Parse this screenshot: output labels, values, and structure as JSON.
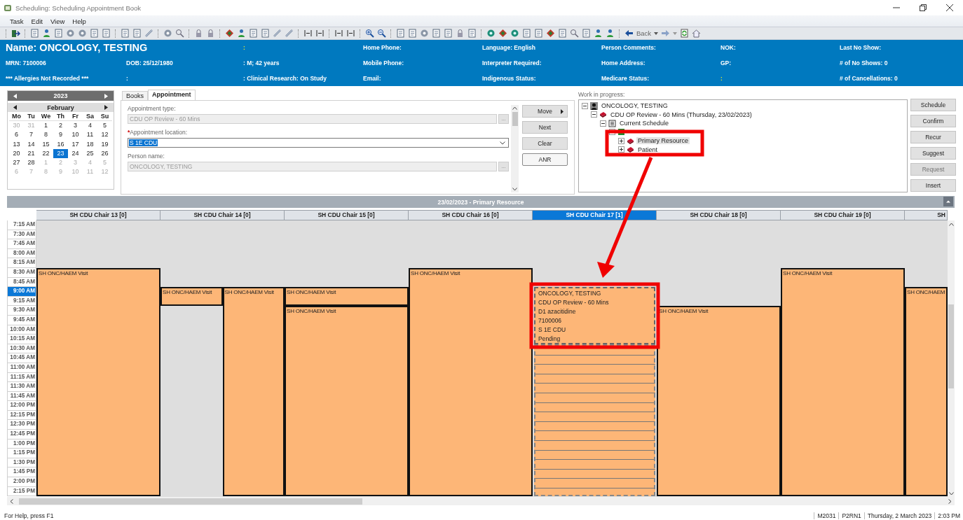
{
  "window": {
    "title": "Scheduling: Scheduling Appointment Book"
  },
  "menu": [
    "Task",
    "Edit",
    "View",
    "Help"
  ],
  "toolbar": {
    "back_label": "Back"
  },
  "banner": {
    "rows": [
      [
        {
          "kind": "name",
          "text": "Name: ONCOLOGY, TESTING"
        },
        {
          "kind": "empty"
        },
        {
          "kind": "flag",
          "text": ":"
        },
        {
          "kind": "label",
          "text": "Home Phone:"
        },
        {
          "kind": "label",
          "text": "Language: English"
        },
        {
          "kind": "label",
          "text": "Person Comments:"
        },
        {
          "kind": "label",
          "text": "NOK:"
        },
        {
          "kind": "label",
          "text": "Last No Show:"
        }
      ],
      [
        {
          "kind": "label",
          "text": "MRN: 7100006"
        },
        {
          "kind": "label",
          "text": "DOB: 25/12/1980"
        },
        {
          "kind": "label",
          "text": ": M; 42 years"
        },
        {
          "kind": "label",
          "text": "Mobile Phone:"
        },
        {
          "kind": "label",
          "text": "Interpreter Required:"
        },
        {
          "kind": "label",
          "text": "Home Address:"
        },
        {
          "kind": "label",
          "text": "GP:"
        },
        {
          "kind": "label",
          "text": "# of No Shows: 0"
        }
      ],
      [
        {
          "kind": "label",
          "text": "*** Allergies Not Recorded ***"
        },
        {
          "kind": "label",
          "text": ":"
        },
        {
          "kind": "label",
          "text": ": Clinical Research: On Study"
        },
        {
          "kind": "label",
          "text": "Email:"
        },
        {
          "kind": "label",
          "text": "Indigenous Status:"
        },
        {
          "kind": "label",
          "text": "Medicare Status:"
        },
        {
          "kind": "flag",
          "text": ":"
        },
        {
          "kind": "label",
          "text": "# of Cancellations: 0"
        }
      ]
    ]
  },
  "calendar": {
    "year": "2023",
    "month": "February",
    "weekdays": [
      "Mo",
      "Tu",
      "We",
      "Th",
      "Fr",
      "Sa",
      "Su"
    ],
    "days": [
      {
        "d": "30",
        "muted": true,
        "selected": false
      },
      {
        "d": "31",
        "muted": true,
        "selected": false
      },
      {
        "d": "1",
        "muted": false,
        "selected": false
      },
      {
        "d": "2",
        "muted": false,
        "selected": false
      },
      {
        "d": "3",
        "muted": false,
        "selected": false
      },
      {
        "d": "4",
        "muted": false,
        "selected": false
      },
      {
        "d": "5",
        "muted": false,
        "selected": false
      },
      {
        "d": "6",
        "muted": false,
        "selected": false
      },
      {
        "d": "7",
        "muted": false,
        "selected": false
      },
      {
        "d": "8",
        "muted": false,
        "selected": false
      },
      {
        "d": "9",
        "muted": false,
        "selected": false
      },
      {
        "d": "10",
        "muted": false,
        "selected": false
      },
      {
        "d": "11",
        "muted": false,
        "selected": false
      },
      {
        "d": "12",
        "muted": false,
        "selected": false
      },
      {
        "d": "13",
        "muted": false,
        "selected": false
      },
      {
        "d": "14",
        "muted": false,
        "selected": false
      },
      {
        "d": "15",
        "muted": false,
        "selected": false
      },
      {
        "d": "16",
        "muted": false,
        "selected": false
      },
      {
        "d": "17",
        "muted": false,
        "selected": false
      },
      {
        "d": "18",
        "muted": false,
        "selected": false
      },
      {
        "d": "19",
        "muted": false,
        "selected": false
      },
      {
        "d": "20",
        "muted": false,
        "selected": false
      },
      {
        "d": "21",
        "muted": false,
        "selected": false
      },
      {
        "d": "22",
        "muted": false,
        "selected": false
      },
      {
        "d": "23",
        "muted": false,
        "selected": true
      },
      {
        "d": "24",
        "muted": false,
        "selected": false
      },
      {
        "d": "25",
        "muted": false,
        "selected": false
      },
      {
        "d": "26",
        "muted": false,
        "selected": false
      },
      {
        "d": "27",
        "muted": false,
        "selected": false
      },
      {
        "d": "28",
        "muted": false,
        "selected": false
      },
      {
        "d": "1",
        "muted": true,
        "selected": false
      },
      {
        "d": "2",
        "muted": true,
        "selected": false
      },
      {
        "d": "3",
        "muted": true,
        "selected": false
      },
      {
        "d": "4",
        "muted": true,
        "selected": false
      },
      {
        "d": "5",
        "muted": true,
        "selected": false
      },
      {
        "d": "6",
        "muted": true,
        "selected": false
      },
      {
        "d": "7",
        "muted": true,
        "selected": false
      },
      {
        "d": "8",
        "muted": true,
        "selected": false
      },
      {
        "d": "9",
        "muted": true,
        "selected": false
      },
      {
        "d": "10",
        "muted": true,
        "selected": false
      },
      {
        "d": "11",
        "muted": true,
        "selected": false
      },
      {
        "d": "12",
        "muted": true,
        "selected": false
      }
    ]
  },
  "appointment_panel": {
    "tabs": [
      {
        "label": "Books",
        "selected": false
      },
      {
        "label": "Appointment",
        "selected": true
      }
    ],
    "fields": [
      {
        "kind": "lookup",
        "label": "Appointment type:",
        "value": "CDU OP Review - 60 Mins",
        "browse": "...",
        "disabled": true
      },
      {
        "kind": "dropdown",
        "required_mark": "*",
        "label": "Appointment location:",
        "value": "S 1E CDU",
        "value_selected": true
      },
      {
        "kind": "lookup",
        "label": "Person name:",
        "value": "ONCOLOGY, TESTING",
        "browse": "...",
        "disabled": true
      }
    ],
    "buttons": [
      {
        "label": "Move",
        "kind": "menu",
        "focused": false
      },
      {
        "label": "Next",
        "kind": "plain",
        "focused": false
      },
      {
        "label": "Clear",
        "kind": "plain",
        "focused": false
      },
      {
        "label": "ANR",
        "kind": "plain",
        "focused": true
      }
    ]
  },
  "wip": {
    "label": "Work in progress:",
    "tree": [
      {
        "label": "ONCOLOGY, TESTING",
        "expanded": true,
        "selected": false,
        "children": [
          {
            "label": "CDU OP Review - 60 Mins (Thursday, 23/02/2023)",
            "expanded": true,
            "selected": false,
            "children": [
              {
                "label": "Current Schedule",
                "expanded": true,
                "selected": false,
                "children": [
                  {
                    "expanded": true,
                    "children": [
                      {
                        "label": "Primary Resource",
                        "expanded": false,
                        "selected": true
                      },
                      {
                        "label": "Patient",
                        "expanded": false,
                        "selected": false
                      }
                    ]
                  }
                ]
              }
            ]
          }
        ]
      }
    ]
  },
  "actions": [
    {
      "label": "Schedule",
      "disabled": false
    },
    {
      "label": "Confirm",
      "disabled": false
    },
    {
      "label": "Recur",
      "disabled": false
    },
    {
      "label": "Suggest",
      "disabled": false
    },
    {
      "label": "Request",
      "disabled": true
    },
    {
      "label": "Insert",
      "disabled": false
    }
  ],
  "grid": {
    "title": "23/02/2023 - Primary Resource",
    "times": [
      {
        "label": "7:15 AM",
        "selected": false
      },
      {
        "label": "7:30 AM",
        "selected": false
      },
      {
        "label": "7:45 AM",
        "selected": false
      },
      {
        "label": "8:00 AM",
        "selected": false
      },
      {
        "label": "8:15 AM",
        "selected": false
      },
      {
        "label": "8:30 AM",
        "selected": false
      },
      {
        "label": "8:45 AM",
        "selected": false
      },
      {
        "label": "9:00 AM",
        "selected": true
      },
      {
        "label": "9:15 AM",
        "selected": false
      },
      {
        "label": "9:30 AM",
        "selected": false
      },
      {
        "label": "9:45 AM",
        "selected": false
      },
      {
        "label": "10:00 AM",
        "selected": false
      },
      {
        "label": "10:15 AM",
        "selected": false
      },
      {
        "label": "10:30 AM",
        "selected": false
      },
      {
        "label": "10:45 AM",
        "selected": false
      },
      {
        "label": "11:00 AM",
        "selected": false
      },
      {
        "label": "11:15 AM",
        "selected": false
      },
      {
        "label": "11:30 AM",
        "selected": false
      },
      {
        "label": "11:45 AM",
        "selected": false
      },
      {
        "label": "12:00 PM",
        "selected": false
      },
      {
        "label": "12:15 PM",
        "selected": false
      },
      {
        "label": "12:30 PM",
        "selected": false
      },
      {
        "label": "12:45 PM",
        "selected": false
      },
      {
        "label": "1:00 PM",
        "selected": false
      },
      {
        "label": "1:15 PM",
        "selected": false
      },
      {
        "label": "1:30 PM",
        "selected": false
      },
      {
        "label": "1:45 PM",
        "selected": false
      },
      {
        "label": "2:00 PM",
        "selected": false
      },
      {
        "label": "2:15 PM",
        "selected": false
      }
    ],
    "columns": [
      {
        "label": "SH CDU Chair 13 [0]",
        "selected": false,
        "lanes": [
          {
            "appointments": [
              {
                "kind": "visit",
                "text": "SH ONC/HAEM Visit"
              }
            ],
            "slots": [
              {
                "kind": "free"
              },
              {
                "kind": "free"
              },
              {
                "kind": "free"
              },
              {
                "kind": "free"
              },
              {
                "kind": "free"
              },
              {
                "kind": "start"
              },
              {
                "kind": "cont"
              },
              {
                "kind": "cont"
              },
              {
                "kind": "cont"
              },
              {
                "kind": "cont"
              },
              {
                "kind": "cont"
              },
              {
                "kind": "cont"
              },
              {
                "kind": "cont"
              },
              {
                "kind": "cont"
              },
              {
                "kind": "cont"
              },
              {
                "kind": "cont"
              },
              {
                "kind": "cont"
              },
              {
                "kind": "cont"
              },
              {
                "kind": "cont"
              },
              {
                "kind": "cont"
              },
              {
                "kind": "cont"
              },
              {
                "kind": "cont"
              },
              {
                "kind": "cont"
              },
              {
                "kind": "cont"
              },
              {
                "kind": "cont"
              },
              {
                "kind": "cont"
              },
              {
                "kind": "cont"
              },
              {
                "kind": "cont"
              },
              {
                "kind": "cont"
              }
            ]
          }
        ]
      },
      {
        "label": "SH CDU Chair 14 [0]",
        "selected": false,
        "lanes": [
          {
            "appointments": [
              {
                "kind": "visit",
                "text": "SH ONC/HAEM Visit"
              }
            ],
            "slots": [
              {
                "kind": "free"
              },
              {
                "kind": "free"
              },
              {
                "kind": "free"
              },
              {
                "kind": "free"
              },
              {
                "kind": "free"
              },
              {
                "kind": "free"
              },
              {
                "kind": "free"
              },
              {
                "kind": "start"
              },
              {
                "kind": "cont"
              },
              {
                "kind": "free"
              },
              {
                "kind": "free"
              },
              {
                "kind": "free"
              },
              {
                "kind": "free"
              },
              {
                "kind": "free"
              },
              {
                "kind": "free"
              },
              {
                "kind": "free"
              },
              {
                "kind": "free"
              },
              {
                "kind": "free"
              },
              {
                "kind": "free"
              },
              {
                "kind": "free"
              },
              {
                "kind": "free"
              },
              {
                "kind": "free"
              },
              {
                "kind": "free"
              },
              {
                "kind": "free"
              },
              {
                "kind": "free"
              },
              {
                "kind": "free"
              },
              {
                "kind": "free"
              },
              {
                "kind": "free"
              },
              {
                "kind": "free"
              }
            ]
          },
          {
            "appointments": [
              {
                "kind": "visit",
                "text": "SH ONC/HAEM Visit"
              }
            ],
            "slots": [
              {
                "kind": "free"
              },
              {
                "kind": "free"
              },
              {
                "kind": "free"
              },
              {
                "kind": "free"
              },
              {
                "kind": "free"
              },
              {
                "kind": "free"
              },
              {
                "kind": "free"
              },
              {
                "kind": "start"
              },
              {
                "kind": "cont"
              },
              {
                "kind": "cont"
              },
              {
                "kind": "cont"
              },
              {
                "kind": "cont"
              },
              {
                "kind": "cont"
              },
              {
                "kind": "cont"
              },
              {
                "kind": "cont"
              },
              {
                "kind": "cont"
              },
              {
                "kind": "cont"
              },
              {
                "kind": "cont"
              },
              {
                "kind": "cont"
              },
              {
                "kind": "cont"
              },
              {
                "kind": "cont"
              },
              {
                "kind": "cont"
              },
              {
                "kind": "cont"
              },
              {
                "kind": "cont"
              },
              {
                "kind": "cont"
              },
              {
                "kind": "cont"
              },
              {
                "kind": "cont"
              },
              {
                "kind": "cont"
              },
              {
                "kind": "cont"
              }
            ]
          }
        ]
      },
      {
        "label": "SH CDU Chair 15 [0]",
        "selected": false,
        "lanes": [
          {
            "appointments": [
              {
                "kind": "visit",
                "text": "SH ONC/HAEM Visit"
              },
              {
                "kind": "visit",
                "text": "SH ONC/HAEM Visit"
              }
            ],
            "slots": [
              {
                "kind": "free"
              },
              {
                "kind": "free"
              },
              {
                "kind": "free"
              },
              {
                "kind": "free"
              },
              {
                "kind": "free"
              },
              {
                "kind": "free"
              },
              {
                "kind": "free"
              },
              {
                "kind": "start"
              },
              {
                "kind": "cont"
              },
              {
                "kind": "start"
              },
              {
                "kind": "cont"
              },
              {
                "kind": "cont"
              },
              {
                "kind": "cont"
              },
              {
                "kind": "cont"
              },
              {
                "kind": "cont"
              },
              {
                "kind": "cont"
              },
              {
                "kind": "cont"
              },
              {
                "kind": "cont"
              },
              {
                "kind": "cont"
              },
              {
                "kind": "cont"
              },
              {
                "kind": "cont"
              },
              {
                "kind": "cont"
              },
              {
                "kind": "cont"
              },
              {
                "kind": "cont"
              },
              {
                "kind": "cont"
              },
              {
                "kind": "cont"
              },
              {
                "kind": "cont"
              },
              {
                "kind": "cont"
              },
              {
                "kind": "cont"
              }
            ]
          }
        ]
      },
      {
        "label": "SH CDU Chair 16 [0]",
        "selected": false,
        "lanes": [
          {
            "appointments": [
              {
                "kind": "visit",
                "text": "SH ONC/HAEM Visit"
              }
            ],
            "slots": [
              {
                "kind": "free"
              },
              {
                "kind": "free"
              },
              {
                "kind": "free"
              },
              {
                "kind": "free"
              },
              {
                "kind": "free"
              },
              {
                "kind": "start"
              },
              {
                "kind": "cont"
              },
              {
                "kind": "cont"
              },
              {
                "kind": "cont"
              },
              {
                "kind": "cont"
              },
              {
                "kind": "cont"
              },
              {
                "kind": "cont"
              },
              {
                "kind": "cont"
              },
              {
                "kind": "cont"
              },
              {
                "kind": "cont"
              },
              {
                "kind": "cont"
              },
              {
                "kind": "cont"
              },
              {
                "kind": "cont"
              },
              {
                "kind": "cont"
              },
              {
                "kind": "cont"
              },
              {
                "kind": "cont"
              },
              {
                "kind": "cont"
              },
              {
                "kind": "cont"
              },
              {
                "kind": "cont"
              },
              {
                "kind": "cont"
              },
              {
                "kind": "cont"
              },
              {
                "kind": "cont"
              },
              {
                "kind": "cont"
              },
              {
                "kind": "cont"
              }
            ]
          }
        ]
      },
      {
        "label": "SH CDU Chair 17 [1]",
        "selected": true,
        "lanes": [
          {
            "appointments": [
              {
                "kind": "booking",
                "lines": [
                  "ONCOLOGY, TESTING",
                  "CDU OP Review - 60 Mins",
                  "D1 azacitidine",
                  "7100006",
                  "S 1E CDU",
                  "Pending"
                ]
              },
              {
                "kind": "open-slot"
              }
            ],
            "slots": [
              {
                "kind": "free"
              },
              {
                "kind": "free"
              },
              {
                "kind": "free"
              },
              {
                "kind": "free"
              },
              {
                "kind": "free"
              },
              {
                "kind": "free"
              },
              {
                "kind": "free"
              },
              {
                "kind": "start"
              },
              {
                "kind": "cont"
              },
              {
                "kind": "cont"
              },
              {
                "kind": "cont"
              },
              {
                "kind": "cont"
              },
              {
                "kind": "cont"
              },
              {
                "kind": "start"
              },
              {
                "kind": "cont"
              },
              {
                "kind": "cont"
              },
              {
                "kind": "cont"
              },
              {
                "kind": "cont"
              },
              {
                "kind": "cont"
              },
              {
                "kind": "cont"
              },
              {
                "kind": "cont"
              },
              {
                "kind": "cont"
              },
              {
                "kind": "cont"
              },
              {
                "kind": "cont"
              },
              {
                "kind": "cont"
              },
              {
                "kind": "cont"
              },
              {
                "kind": "cont"
              },
              {
                "kind": "cont"
              },
              {
                "kind": "cont"
              }
            ]
          }
        ]
      },
      {
        "label": "SH CDU Chair 18 [0]",
        "selected": false,
        "lanes": [
          {
            "appointments": [
              {
                "kind": "visit",
                "text": "SH ONC/HAEM Visit"
              }
            ],
            "slots": [
              {
                "kind": "free"
              },
              {
                "kind": "free"
              },
              {
                "kind": "free"
              },
              {
                "kind": "free"
              },
              {
                "kind": "free"
              },
              {
                "kind": "free"
              },
              {
                "kind": "free"
              },
              {
                "kind": "free"
              },
              {
                "kind": "free"
              },
              {
                "kind": "start"
              },
              {
                "kind": "cont"
              },
              {
                "kind": "cont"
              },
              {
                "kind": "cont"
              },
              {
                "kind": "cont"
              },
              {
                "kind": "cont"
              },
              {
                "kind": "cont"
              },
              {
                "kind": "cont"
              },
              {
                "kind": "cont"
              },
              {
                "kind": "cont"
              },
              {
                "kind": "cont"
              },
              {
                "kind": "cont"
              },
              {
                "kind": "cont"
              },
              {
                "kind": "cont"
              },
              {
                "kind": "cont"
              },
              {
                "kind": "cont"
              },
              {
                "kind": "cont"
              },
              {
                "kind": "cont"
              },
              {
                "kind": "cont"
              },
              {
                "kind": "cont"
              }
            ]
          }
        ]
      },
      {
        "label": "SH CDU Chair 19 [0]",
        "selected": false,
        "lanes": [
          {
            "appointments": [
              {
                "kind": "visit",
                "text": "SH ONC/HAEM Visit"
              }
            ],
            "slots": [
              {
                "kind": "free"
              },
              {
                "kind": "free"
              },
              {
                "kind": "free"
              },
              {
                "kind": "free"
              },
              {
                "kind": "free"
              },
              {
                "kind": "start"
              },
              {
                "kind": "cont"
              },
              {
                "kind": "cont"
              },
              {
                "kind": "cont"
              },
              {
                "kind": "cont"
              },
              {
                "kind": "cont"
              },
              {
                "kind": "cont"
              },
              {
                "kind": "cont"
              },
              {
                "kind": "cont"
              },
              {
                "kind": "cont"
              },
              {
                "kind": "cont"
              },
              {
                "kind": "cont"
              },
              {
                "kind": "cont"
              },
              {
                "kind": "cont"
              },
              {
                "kind": "cont"
              },
              {
                "kind": "cont"
              },
              {
                "kind": "cont"
              },
              {
                "kind": "cont"
              },
              {
                "kind": "cont"
              },
              {
                "kind": "cont"
              },
              {
                "kind": "cont"
              },
              {
                "kind": "cont"
              },
              {
                "kind": "cont"
              },
              {
                "kind": "cont"
              }
            ]
          }
        ]
      },
      {
        "label": "SH",
        "selected": false,
        "lanes": [
          {
            "appointments": [
              {
                "kind": "visit",
                "text": "SH ONC/HAEM"
              }
            ],
            "slots": [
              {
                "kind": "free"
              },
              {
                "kind": "free"
              },
              {
                "kind": "free"
              },
              {
                "kind": "free"
              },
              {
                "kind": "free"
              },
              {
                "kind": "free"
              },
              {
                "kind": "free"
              },
              {
                "kind": "start"
              },
              {
                "kind": "cont"
              },
              {
                "kind": "cont"
              },
              {
                "kind": "cont"
              },
              {
                "kind": "cont"
              },
              {
                "kind": "cont"
              },
              {
                "kind": "cont"
              },
              {
                "kind": "cont"
              },
              {
                "kind": "cont"
              },
              {
                "kind": "cont"
              },
              {
                "kind": "cont"
              },
              {
                "kind": "cont"
              },
              {
                "kind": "cont"
              },
              {
                "kind": "cont"
              },
              {
                "kind": "cont"
              },
              {
                "kind": "cont"
              },
              {
                "kind": "cont"
              },
              {
                "kind": "cont"
              },
              {
                "kind": "cont"
              },
              {
                "kind": "cont"
              },
              {
                "kind": "cont"
              },
              {
                "kind": "cont"
              }
            ]
          }
        ]
      }
    ]
  },
  "status_bar": {
    "help": "For Help, press F1",
    "panes": [
      "M2031",
      "P2RN1",
      "Thursday, 2 March 2023",
      "2:03 PM"
    ]
  }
}
